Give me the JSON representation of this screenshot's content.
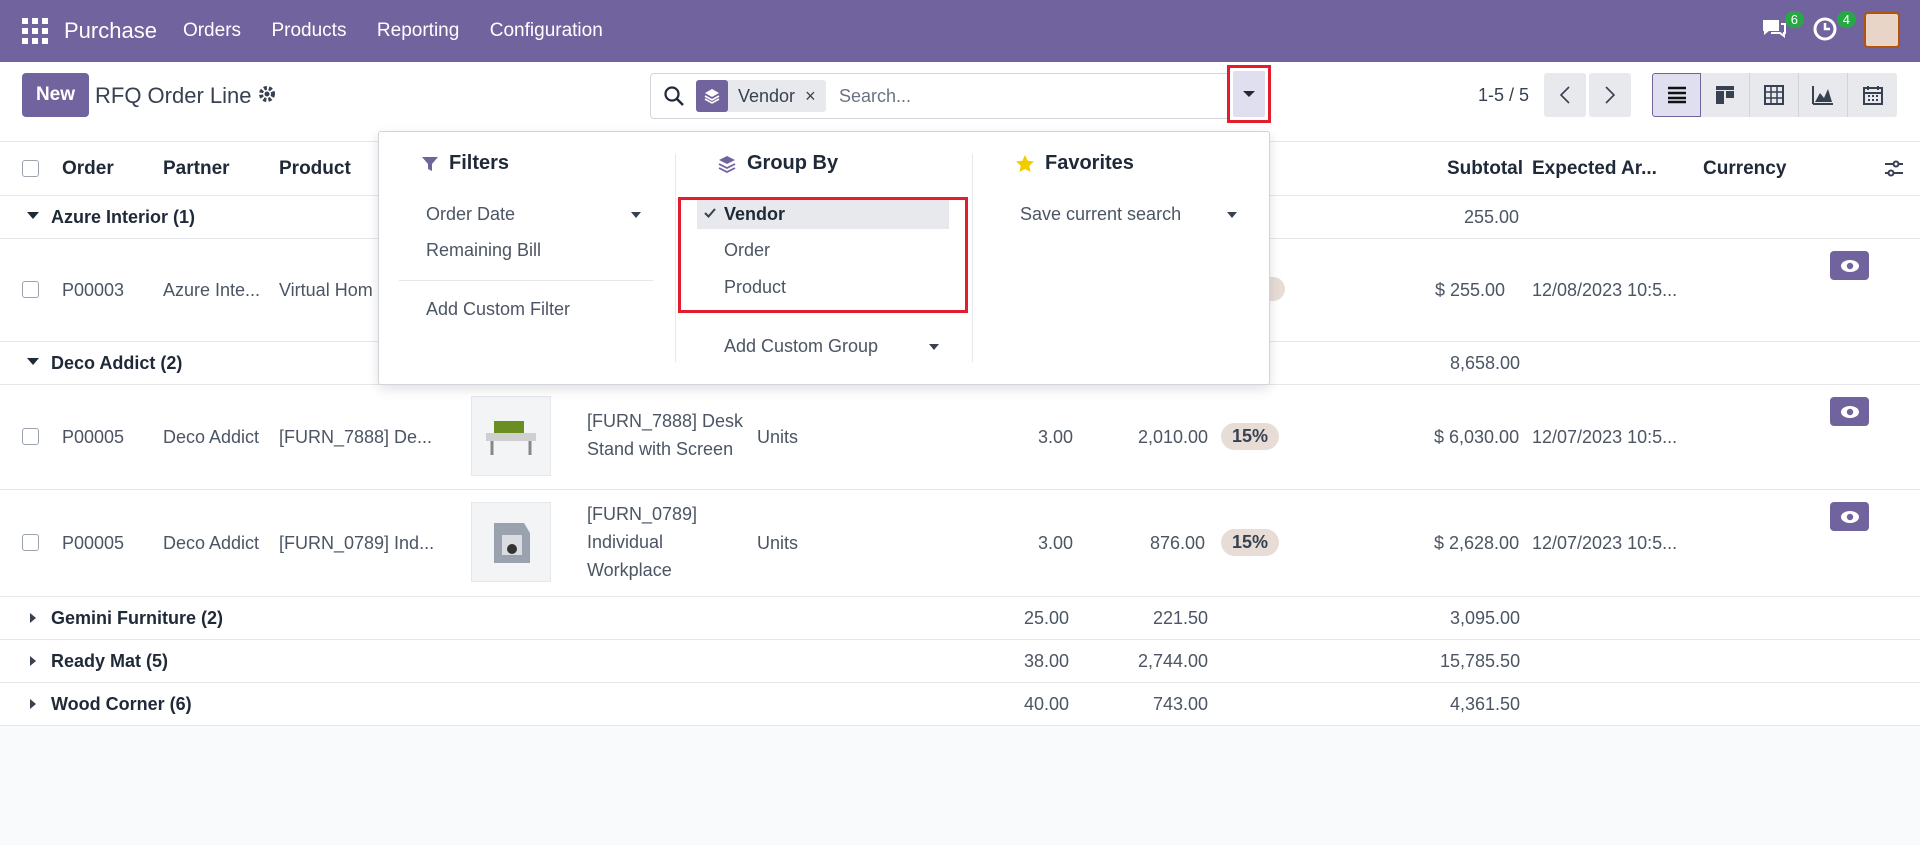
{
  "topbar": {
    "app_title": "Purchase",
    "nav": [
      "Orders",
      "Products",
      "Reporting",
      "Configuration"
    ],
    "chat_count": "6",
    "activity_count": "4"
  },
  "control": {
    "new_label": "New",
    "breadcrumb": "RFQ Order Line",
    "facet_value": "Vendor",
    "facet_remove": "×",
    "search_placeholder": "Search...",
    "pager": "1-5 / 5"
  },
  "columns": {
    "order": "Order",
    "partner": "Partner",
    "product": "Product",
    "subtotal": "Subtotal",
    "expected": "Expected Ar...",
    "currency": "Currency"
  },
  "groups": {
    "azure": {
      "label": "Azure Interior (1)",
      "subtotal": "255.00"
    },
    "deco": {
      "label": "Deco Addict (2)",
      "subtotal": "8,658.00"
    },
    "gemini": {
      "label": "Gemini Furniture (2)",
      "qty": "25.00",
      "price": "221.50",
      "subtotal": "3,095.00"
    },
    "ready": {
      "label": "Ready Mat (5)",
      "qty": "38.00",
      "price": "2,744.00",
      "subtotal": "15,785.50"
    },
    "wood": {
      "label": "Wood Corner (6)",
      "qty": "40.00",
      "price": "743.00",
      "subtotal": "4,361.50"
    }
  },
  "rows": [
    {
      "order": "P00003",
      "partner": "Azure Inte...",
      "product": "Virtual Hom",
      "subtotal": "$ 255.00",
      "expected": "12/08/2023 10:5..."
    },
    {
      "order": "P00005",
      "partner": "Deco Addict",
      "product": "[FURN_7888] De...",
      "desc1": "[FURN_7888] Desk",
      "desc2": "Stand with Screen",
      "uom": "Units",
      "qty": "3.00",
      "price": "2,010.00",
      "disc": "15%",
      "subtotal": "$ 6,030.00",
      "expected": "12/07/2023 10:5..."
    },
    {
      "order": "P00005",
      "partner": "Deco Addict",
      "product": "[FURN_0789] Ind...",
      "desc1": "[FURN_0789]",
      "desc2": "Individual",
      "desc3": "Workplace",
      "uom": "Units",
      "qty": "3.00",
      "price": "876.00",
      "disc": "15%",
      "subtotal": "$ 2,628.00",
      "expected": "12/07/2023 10:5..."
    }
  ],
  "dropdown": {
    "filters_title": "Filters",
    "filters": [
      "Order Date",
      "Remaining Bill"
    ],
    "add_custom_filter": "Add Custom Filter",
    "groupby_title": "Group By",
    "groupby": [
      "Vendor",
      "Order",
      "Product"
    ],
    "add_custom_group": "Add Custom Group",
    "favorites_title": "Favorites",
    "save_current_search": "Save current search"
  },
  "colors": {
    "brand": "#71639e",
    "highlight": "#e11d2e",
    "badge": "#28a745"
  }
}
